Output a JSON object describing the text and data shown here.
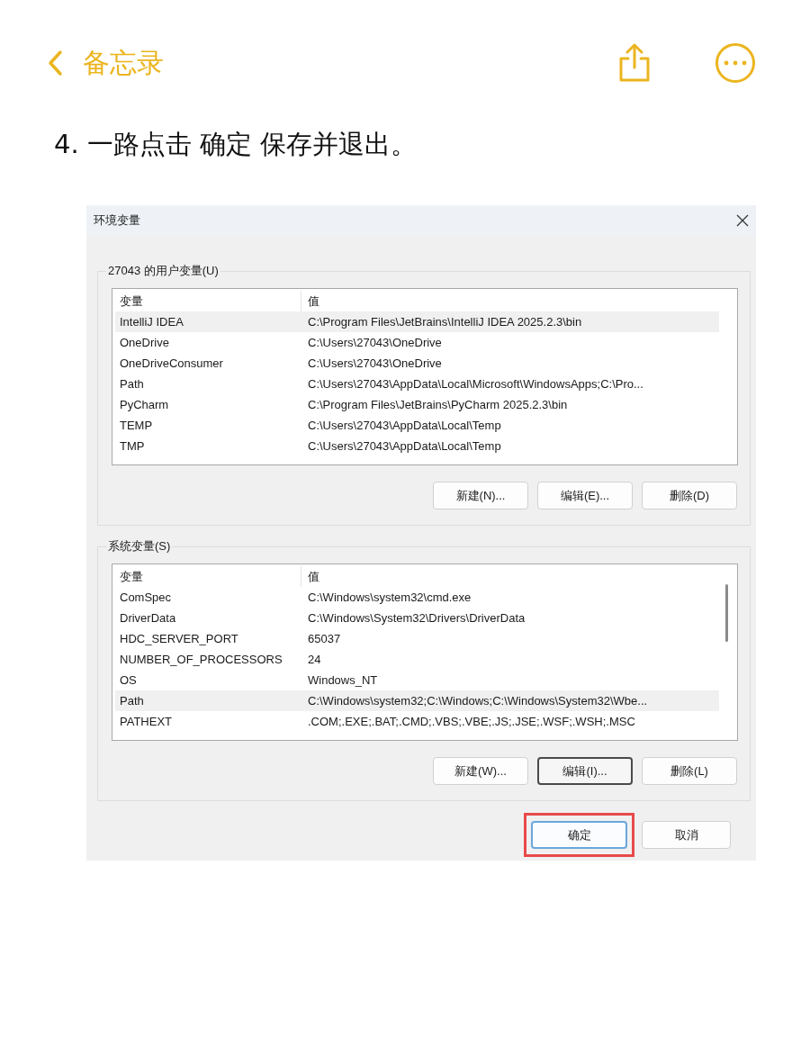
{
  "app_bar": {
    "back_label": "备忘录"
  },
  "note": {
    "text": "4. 一路点击 确定 保存并退出。"
  },
  "dialog": {
    "title": "环境变量",
    "groups": [
      {
        "label": "27043 的用户变量(U)",
        "scrollbar": false,
        "columns": [
          "变量",
          "值"
        ],
        "rows": [
          {
            "name": "IntelliJ IDEA",
            "value": "C:\\Program Files\\JetBrains\\IntelliJ IDEA 2025.2.3\\bin",
            "selected": true
          },
          {
            "name": "OneDrive",
            "value": "C:\\Users\\27043\\OneDrive",
            "selected": false
          },
          {
            "name": "OneDriveConsumer",
            "value": "C:\\Users\\27043\\OneDrive",
            "selected": false
          },
          {
            "name": "Path",
            "value": "C:\\Users\\27043\\AppData\\Local\\Microsoft\\WindowsApps;C:\\Pro...",
            "selected": false
          },
          {
            "name": "PyCharm",
            "value": "C:\\Program Files\\JetBrains\\PyCharm 2025.2.3\\bin",
            "selected": false
          },
          {
            "name": "TEMP",
            "value": "C:\\Users\\27043\\AppData\\Local\\Temp",
            "selected": false
          },
          {
            "name": "TMP",
            "value": "C:\\Users\\27043\\AppData\\Local\\Temp",
            "selected": false
          }
        ],
        "buttons": [
          {
            "label": "新建(N)...",
            "focused": false
          },
          {
            "label": "编辑(E)...",
            "focused": false
          },
          {
            "label": "删除(D)",
            "focused": false
          }
        ]
      },
      {
        "label": "系统变量(S)",
        "scrollbar": true,
        "columns": [
          "变量",
          "值"
        ],
        "rows": [
          {
            "name": "ComSpec",
            "value": "C:\\Windows\\system32\\cmd.exe",
            "selected": false
          },
          {
            "name": "DriverData",
            "value": "C:\\Windows\\System32\\Drivers\\DriverData",
            "selected": false
          },
          {
            "name": "HDC_SERVER_PORT",
            "value": "65037",
            "selected": false
          },
          {
            "name": "NUMBER_OF_PROCESSORS",
            "value": "24",
            "selected": false
          },
          {
            "name": "OS",
            "value": "Windows_NT",
            "selected": false
          },
          {
            "name": "Path",
            "value": "C:\\Windows\\system32;C:\\Windows;C:\\Windows\\System32\\Wbe...",
            "selected": true
          },
          {
            "name": "PATHEXT",
            "value": ".COM;.EXE;.BAT;.CMD;.VBS;.VBE;.JS;.JSE;.WSF;.WSH;.MSC",
            "selected": false
          }
        ],
        "buttons": [
          {
            "label": "新建(W)...",
            "focused": false
          },
          {
            "label": "编辑(I)...",
            "focused": true
          },
          {
            "label": "删除(L)",
            "focused": false
          }
        ]
      }
    ],
    "footer_buttons": [
      {
        "label": "确定",
        "default": true,
        "highlighted": true
      },
      {
        "label": "取消",
        "default": false,
        "highlighted": false
      }
    ]
  }
}
